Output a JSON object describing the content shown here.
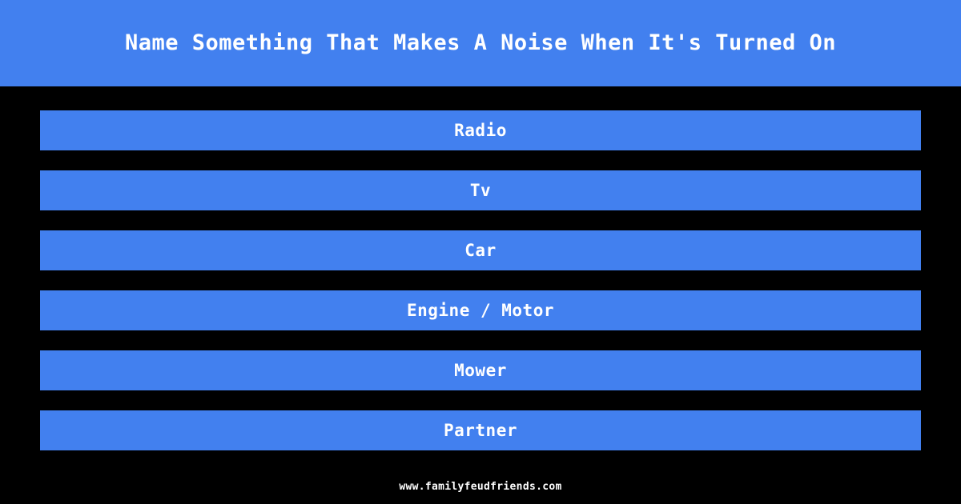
{
  "header": {
    "title": "Name Something That Makes A Noise When It's Turned On",
    "background_color": "#4280ef",
    "text_color": "#ffffff"
  },
  "page": {
    "background_color": "#000000"
  },
  "answers": [
    {
      "label": "Radio"
    },
    {
      "label": "Tv"
    },
    {
      "label": "Car"
    },
    {
      "label": "Engine / Motor"
    },
    {
      "label": "Mower"
    },
    {
      "label": "Partner"
    }
  ],
  "footer": {
    "site": "www.familyfeudfriends.com"
  }
}
